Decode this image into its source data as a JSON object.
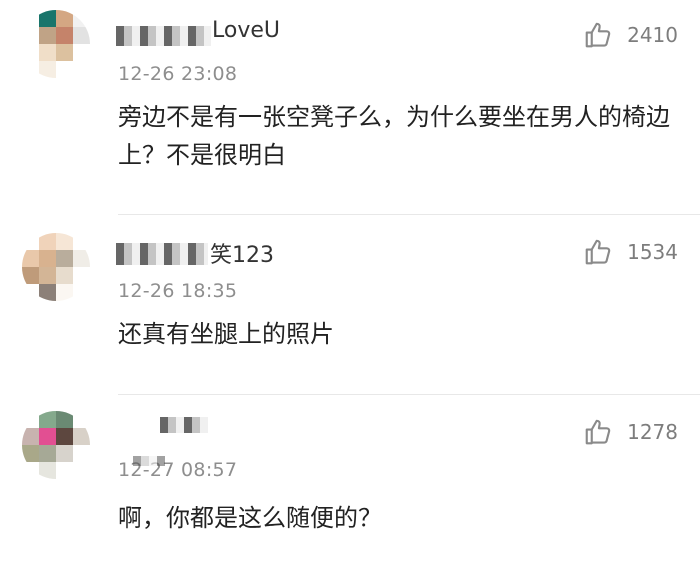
{
  "comments": [
    {
      "name": "LoveU",
      "time": "12-26 23:08",
      "text": "旁边不是有一张空凳子么，为什么要坐在男人的椅边上？不是很明白",
      "likes": "2410",
      "avatar_colors": [
        "#ffffff",
        "#19756b",
        "#d4a783",
        "#f1f1f1",
        "#ffffff",
        "#c0a386",
        "#c5836a",
        "#e2e2e2",
        "#ffffff",
        "#f0dec8",
        "#dcc19f",
        "#ffffff",
        "#ffffff",
        "#f6eee3",
        "#ffffff",
        "#ffffff"
      ]
    },
    {
      "name": "笑123",
      "time": "12-26 18:35",
      "text": "还真有坐腿上的照片",
      "likes": "1534",
      "avatar_colors": [
        "#ffffff",
        "#f0d3ba",
        "#f6e6d6",
        "#ffffff",
        "#e9c8aa",
        "#d8b28f",
        "#b9ad9c",
        "#f0ede7",
        "#bf9b7a",
        "#d3b596",
        "#e7dccd",
        "#ffffff",
        "#ffffff",
        "#8c8078",
        "#fbf7f2",
        "#ffffff"
      ]
    },
    {
      "name": "",
      "time": "12-27 08:57",
      "text": "啊，你都是这么随便的？",
      "likes": "1278",
      "avatar_colors": [
        "#ffffff",
        "#84a98c",
        "#6a8a73",
        "#ffffff",
        "#c8b3af",
        "#e24f92",
        "#5d473f",
        "#d8d1c8",
        "#a9a889",
        "#a6a996",
        "#d7d3cc",
        "#ffffff",
        "#ffffff",
        "#e6e6df",
        "#ffffff",
        "#ffffff"
      ]
    }
  ]
}
